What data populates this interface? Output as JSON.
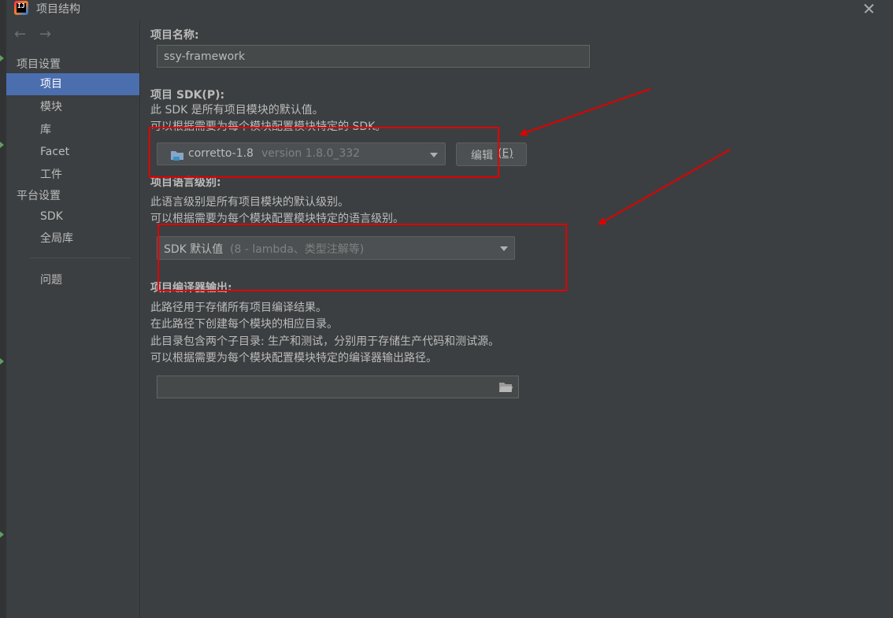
{
  "window": {
    "title": "项目结构",
    "app_icon_text": "IJ"
  },
  "sidebar": {
    "sections": [
      {
        "label": "项目设置",
        "items": [
          "项目",
          "模块",
          "库",
          "Facet",
          "工件"
        ]
      },
      {
        "label": "平台设置",
        "items": [
          "SDK",
          "全局库"
        ]
      }
    ],
    "extra_item": "问题",
    "selected_item": "项目"
  },
  "main": {
    "project_name": {
      "label": "项目名称:",
      "value": "ssy-framework"
    },
    "sdk": {
      "label": "项目 SDK(P):",
      "desc1": "此 SDK 是所有项目模块的默认值。",
      "desc2": "可以根据需要为每个模块配置模块特定的 SDK。",
      "selected_name": "corretto-1.8",
      "selected_version": "version 1.8.0_332",
      "edit_button": "编辑",
      "edit_mnemonic": "(E)"
    },
    "language_level": {
      "label": "项目语言级别:",
      "desc1": "此语言级别是所有项目模块的默认级别。",
      "desc2": "可以根据需要为每个模块配置模块特定的语言级别。",
      "selected": "SDK 默认值",
      "selected_detail": "(8 - lambda、类型注解等)"
    },
    "compiler_output": {
      "label": "项目编译器输出:",
      "desc1": "此路径用于存储所有项目编译结果。",
      "desc2": "在此路径下创建每个模块的相应目录。",
      "desc3": "此目录包含两个子目录: 生产和测试，分别用于存储生产代码和测试源。",
      "desc4": "可以根据需要为每个模块配置模块特定的编译器输出路径。",
      "path_value": ""
    }
  },
  "colors": {
    "background": "#3c3f41",
    "selection": "#4b6eaf",
    "annotation": "#e00000"
  },
  "icons": [
    "back-arrow-icon",
    "forward-arrow-icon",
    "close-icon",
    "folder-icon",
    "chevron-down-icon",
    "app-icon"
  ]
}
